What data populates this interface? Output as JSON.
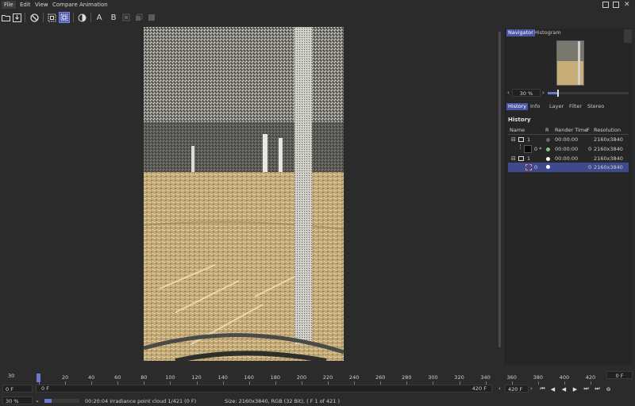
{
  "menu": {
    "file": "File",
    "edit": "Edit",
    "view": "View",
    "compare": "Compare",
    "animation": "Animation"
  },
  "toolbar": {
    "icons": [
      "open-folder-icon",
      "save-icon",
      "clear-icon",
      "region-render-icon",
      "focus-pick-icon",
      "compare-split-icon",
      "compare-a-icon",
      "compare-b-icon",
      "lock-icon",
      "restore-icon",
      "copy-icon"
    ],
    "a_label": "A",
    "b_label": "B"
  },
  "navigator": {
    "tab_navigator": "Navigator",
    "tab_histogram": "Histogram",
    "zoom": "30 %"
  },
  "panel_tabs": {
    "history": "History",
    "info": "Info",
    "layer": "Layer",
    "filter": "Filter",
    "stereo": "Stereo"
  },
  "history": {
    "title": "History",
    "columns": {
      "name": "Name",
      "r": "R",
      "render_time": "Render Time",
      "f": "F",
      "resolution": "Resolution"
    },
    "rows": [
      {
        "name": "1",
        "time": "00:00:00",
        "f": "",
        "res": "2160x3840"
      },
      {
        "name": "0 *",
        "time": "00:00:00",
        "f": "0",
        "res": "2160x3840"
      },
      {
        "name": "1",
        "time": "00:00:00",
        "f": "",
        "res": "2160x3840"
      },
      {
        "name": "0",
        "time": "00:00:00",
        "f": "0",
        "res": "2160x3840"
      }
    ]
  },
  "timeline": {
    "ticks": [
      "0",
      "20",
      "40",
      "60",
      "80",
      "100",
      "120",
      "140",
      "160",
      "180",
      "200",
      "220",
      "240",
      "260",
      "280",
      "300",
      "320",
      "340",
      "360",
      "380",
      "400",
      "420"
    ],
    "left_value": "30",
    "right_value": "0 F",
    "start_frame": "0 F",
    "current_frame_field": "0 F",
    "end_frame": "420 F",
    "end_frame_field": "420 F"
  },
  "status": {
    "zoom": "30 %",
    "progress": "00:20:04 Irradiance point cloud 1/421 (0 F)",
    "info": "Size: 2160x3840, RGB (32 Bit),  ( F 1 of 421 )",
    "progress_fraction": 0.2
  }
}
